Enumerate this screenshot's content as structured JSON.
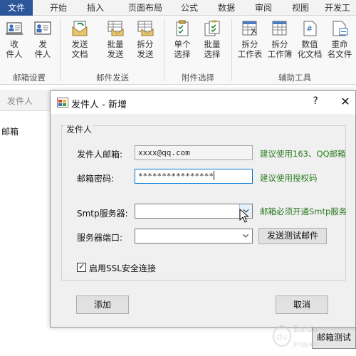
{
  "ribbon": {
    "tabs": [
      {
        "label": "文件",
        "active": true
      },
      {
        "label": "开始"
      },
      {
        "label": "插入"
      },
      {
        "label": "页面布局"
      },
      {
        "label": "公式"
      },
      {
        "label": "数据"
      },
      {
        "label": "审阅"
      },
      {
        "label": "视图"
      },
      {
        "label": "开发工"
      }
    ],
    "buttons": [
      {
        "line1": "收",
        "line2": "件人",
        "icon": "inbox-contact-icon"
      },
      {
        "line1": "发",
        "line2": "件人",
        "icon": "sender-card-icon"
      },
      {
        "line1": "发送",
        "line2": "文档",
        "icon": "send-document-icon"
      },
      {
        "line1": "批量",
        "line2": "发送",
        "icon": "batch-send-icon"
      },
      {
        "line1": "拆分",
        "line2": "发送",
        "icon": "split-send-icon"
      },
      {
        "line1": "单个",
        "line2": "选择",
        "icon": "single-select-icon"
      },
      {
        "line1": "批量",
        "line2": "选择",
        "icon": "batch-select-icon"
      },
      {
        "line1": "拆分",
        "line2": "工作表",
        "icon": "split-sheet-icon"
      },
      {
        "line1": "拆分",
        "line2": "工作簿",
        "icon": "split-workbook-icon"
      },
      {
        "line1": "数值",
        "line2": "化文档",
        "icon": "numeric-document-icon"
      },
      {
        "line1": "重命",
        "line2": "名文件",
        "icon": "rename-file-icon"
      }
    ],
    "groups": [
      "邮箱设置",
      "邮件发送",
      "附件选择",
      "辅助工具"
    ]
  },
  "background": {
    "sender_header": "发件人",
    "mailbox_text": "邮箱",
    "bottom_button": "邮箱测试"
  },
  "dialog": {
    "title": "发件人 - 新增",
    "help": "?",
    "close": "✕",
    "group_title": "发件人",
    "email_label": "发件人邮箱:",
    "email_value": "xxxx@qq.com",
    "email_hint": "建议使用163、QQ邮箱",
    "password_label": "邮箱密码:",
    "password_value": "****************",
    "password_hint": "建议使用授权码",
    "smtp_label": "Smtp服务器:",
    "smtp_value": "",
    "smtp_hint": "邮箱必须开通Smtp服务",
    "port_label": "服务器端口:",
    "port_value": "",
    "test_button": "发送测试邮件",
    "ssl_label": "启用SSL安全连接",
    "ssl_checked": true,
    "add_button": "添加",
    "cancel_button": "取消"
  },
  "watermark": {
    "text": "Baidu 经验",
    "mark": "jingyan.baidu.com"
  },
  "colors": {
    "accent": "#2b579a",
    "hint_green": "#2a7a20",
    "focus_blue": "#0078d7"
  }
}
